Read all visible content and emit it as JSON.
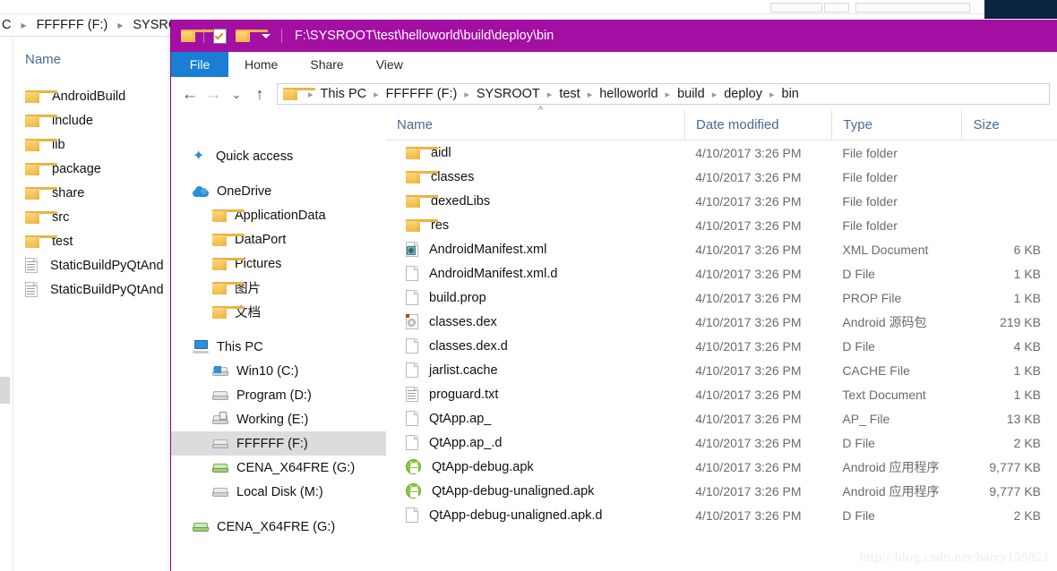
{
  "background_window": {
    "breadcrumb": [
      "C",
      "FFFFFF (F:)",
      "SYSROOT"
    ],
    "column_header": "Name",
    "items": [
      {
        "name": "AndroidBuild",
        "icon": "folder-icon"
      },
      {
        "name": "include",
        "icon": "folder-icon"
      },
      {
        "name": "lib",
        "icon": "folder-icon"
      },
      {
        "name": "package",
        "icon": "folder-icon"
      },
      {
        "name": "share",
        "icon": "folder-icon"
      },
      {
        "name": "src",
        "icon": "folder-icon"
      },
      {
        "name": "test",
        "icon": "folder-icon"
      },
      {
        "name": "StaticBuildPyQtAnd",
        "icon": "text-document-icon"
      },
      {
        "name": "StaticBuildPyQtAnd",
        "icon": "text-document-icon"
      }
    ]
  },
  "window": {
    "title": "F:\\SYSROOT\\test\\helloworld\\build\\deploy\\bin",
    "quick_access_toolbar": [
      {
        "name": "folder-icon",
        "label": ""
      },
      {
        "name": "properties-icon",
        "label": ""
      },
      {
        "name": "new-folder-icon",
        "label": ""
      },
      {
        "name": "chevron-down-icon",
        "label": ""
      }
    ],
    "ribbon_tabs": [
      {
        "label": "File",
        "active": true
      },
      {
        "label": "Home",
        "active": false
      },
      {
        "label": "Share",
        "active": false
      },
      {
        "label": "View",
        "active": false
      }
    ],
    "nav_buttons": {
      "back": "←",
      "forward": "→",
      "history": "⌄",
      "up": "↑"
    },
    "breadcrumb": [
      "This PC",
      "FFFFFF (F:)",
      "SYSROOT",
      "test",
      "helloworld",
      "build",
      "deploy",
      "bin"
    ]
  },
  "nav_pane": {
    "items": [
      {
        "label": "Quick access",
        "icon": "star-icon",
        "level": 0,
        "selected": false
      },
      {
        "label": "OneDrive",
        "icon": "cloud-icon",
        "level": 0,
        "selected": false
      },
      {
        "label": "ApplicationData",
        "icon": "folder-icon",
        "level": 1,
        "selected": false
      },
      {
        "label": "DataPort",
        "icon": "folder-icon",
        "level": 1,
        "selected": false
      },
      {
        "label": "Pictures",
        "icon": "folder-icon",
        "level": 1,
        "selected": false
      },
      {
        "label": "图片",
        "icon": "folder-icon",
        "level": 1,
        "selected": false
      },
      {
        "label": "文档",
        "icon": "folder-icon",
        "level": 1,
        "selected": false
      },
      {
        "label": "This PC",
        "icon": "pc-icon",
        "level": 0,
        "selected": false
      },
      {
        "label": "Win10 (C:)",
        "icon": "windows-drive-icon",
        "level": 1,
        "selected": false
      },
      {
        "label": "Program (D:)",
        "icon": "drive-icon",
        "level": 1,
        "selected": false
      },
      {
        "label": "Working (E:)",
        "icon": "locked-drive-icon",
        "level": 1,
        "selected": false
      },
      {
        "label": "FFFFFF (F:)",
        "icon": "drive-icon",
        "level": 1,
        "selected": true
      },
      {
        "label": "CENA_X64FRE (G:)",
        "icon": "optical-drive-icon",
        "level": 1,
        "selected": false
      },
      {
        "label": "Local Disk (M:)",
        "icon": "drive-icon",
        "level": 1,
        "selected": false
      },
      {
        "label": "CENA_X64FRE (G:)",
        "icon": "optical-drive-icon",
        "level": 0,
        "selected": false
      }
    ]
  },
  "file_list": {
    "columns": [
      "Name",
      "Date modified",
      "Type",
      "Size"
    ],
    "sort_column": "Name",
    "sort_direction": "ascending",
    "rows": [
      {
        "name": "aidl",
        "icon": "folder-icon",
        "date": "4/10/2017 3:26 PM",
        "type": "File folder",
        "size": ""
      },
      {
        "name": "classes",
        "icon": "folder-icon",
        "date": "4/10/2017 3:26 PM",
        "type": "File folder",
        "size": ""
      },
      {
        "name": "dexedLibs",
        "icon": "folder-icon",
        "date": "4/10/2017 3:26 PM",
        "type": "File folder",
        "size": ""
      },
      {
        "name": "res",
        "icon": "folder-icon",
        "date": "4/10/2017 3:26 PM",
        "type": "File folder",
        "size": ""
      },
      {
        "name": "AndroidManifest.xml",
        "icon": "xml-document-icon",
        "date": "4/10/2017 3:26 PM",
        "type": "XML Document",
        "size": "6 KB"
      },
      {
        "name": "AndroidManifest.xml.d",
        "icon": "blank-file-icon",
        "date": "4/10/2017 3:26 PM",
        "type": "D File",
        "size": "1 KB"
      },
      {
        "name": "build.prop",
        "icon": "blank-file-icon",
        "date": "4/10/2017 3:26 PM",
        "type": "PROP File",
        "size": "1 KB"
      },
      {
        "name": "classes.dex",
        "icon": "dex-file-icon",
        "date": "4/10/2017 3:26 PM",
        "type": "Android 源码包",
        "size": "219 KB"
      },
      {
        "name": "classes.dex.d",
        "icon": "blank-file-icon",
        "date": "4/10/2017 3:26 PM",
        "type": "D File",
        "size": "4 KB"
      },
      {
        "name": "jarlist.cache",
        "icon": "blank-file-icon",
        "date": "4/10/2017 3:26 PM",
        "type": "CACHE File",
        "size": "1 KB"
      },
      {
        "name": "proguard.txt",
        "icon": "text-document-icon",
        "date": "4/10/2017 3:26 PM",
        "type": "Text Document",
        "size": "1 KB"
      },
      {
        "name": "QtApp.ap_",
        "icon": "blank-file-icon",
        "date": "4/10/2017 3:26 PM",
        "type": "AP_ File",
        "size": "13 KB"
      },
      {
        "name": "QtApp.ap_.d",
        "icon": "blank-file-icon",
        "date": "4/10/2017 3:26 PM",
        "type": "D File",
        "size": "2 KB"
      },
      {
        "name": "QtApp-debug.apk",
        "icon": "android-apk-icon",
        "date": "4/10/2017 3:26 PM",
        "type": "Android 应用程序",
        "size": "9,777 KB"
      },
      {
        "name": "QtApp-debug-unaligned.apk",
        "icon": "android-apk-icon",
        "date": "4/10/2017 3:26 PM",
        "type": "Android 应用程序",
        "size": "9,777 KB"
      },
      {
        "name": "QtApp-debug-unaligned.apk.d",
        "icon": "blank-file-icon",
        "date": "4/10/2017 3:26 PM",
        "type": "D File",
        "size": "2 KB"
      }
    ]
  },
  "watermark": "http://blog.csdn.net/harry159821",
  "colors": {
    "titlebar": "#a30ea3",
    "file_tab": "#1a7fd4",
    "selection": "#dcdcdc",
    "header_text": "#4a6a92",
    "navy_patch": "#0a2540"
  }
}
